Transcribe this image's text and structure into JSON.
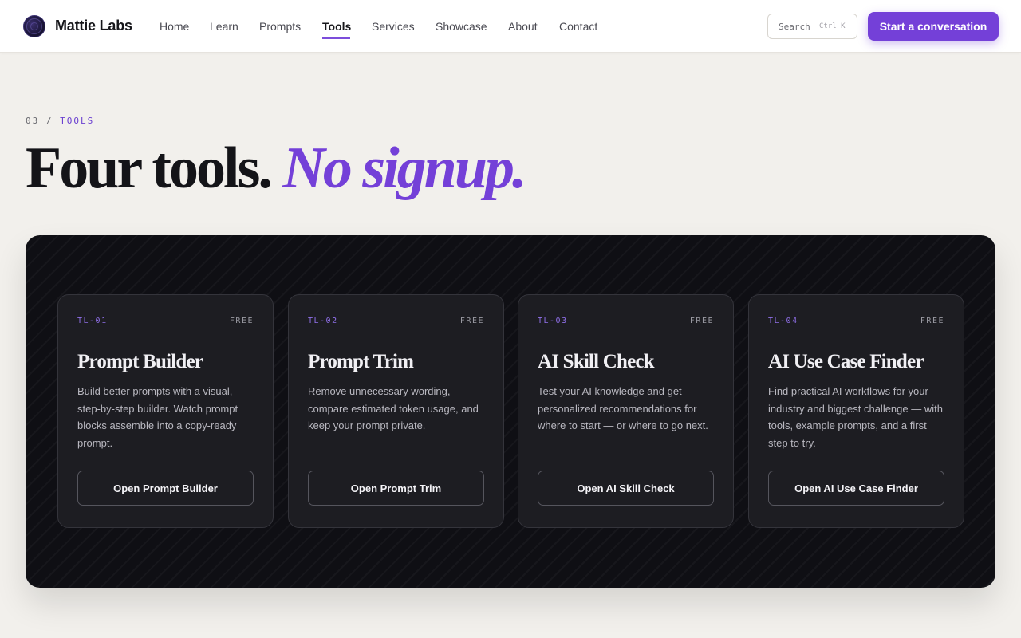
{
  "header": {
    "brand": "Mattie Labs",
    "logo_icon": "orbit-logo-icon",
    "nav": [
      "Home",
      "Learn",
      "Prompts",
      "Tools",
      "Services",
      "Showcase",
      "About",
      "Contact"
    ],
    "active_nav": "Tools",
    "search_label": "Search",
    "search_shortcut": "Ctrl K",
    "cta_label": "Start a conversation"
  },
  "hero": {
    "eyebrow_index": "03 /",
    "eyebrow_section": "TOOLS",
    "headline_plain": "Four tools.",
    "headline_accent": "No signup."
  },
  "tools": [
    {
      "id": "TL-01",
      "tag": "FREE",
      "title": "Prompt Builder",
      "description": "Build better prompts with a visual, step-by-step builder. Watch prompt blocks assemble into a copy-ready prompt.",
      "button": "Open Prompt Builder"
    },
    {
      "id": "TL-02",
      "tag": "FREE",
      "title": "Prompt Trim",
      "description": "Remove unnecessary wording, compare estimated token usage, and keep your prompt private.",
      "button": "Open Prompt Trim"
    },
    {
      "id": "TL-03",
      "tag": "FREE",
      "title": "AI Skill Check",
      "description": "Test your AI knowledge and get personalized recommendations for where to start — or where to go next.",
      "button": "Open AI Skill Check"
    },
    {
      "id": "TL-04",
      "tag": "FREE",
      "title": "AI Use Case Finder",
      "description": "Find practical AI workflows for your industry and biggest challenge — with tools, example prompts, and a first step to try.",
      "button": "Open AI Use Case Finder"
    }
  ],
  "colors": {
    "accent": "#7440d8",
    "page_bg": "#f2f0ec",
    "panel_bg": "#0f0f14",
    "card_bg": "#1d1d22"
  }
}
